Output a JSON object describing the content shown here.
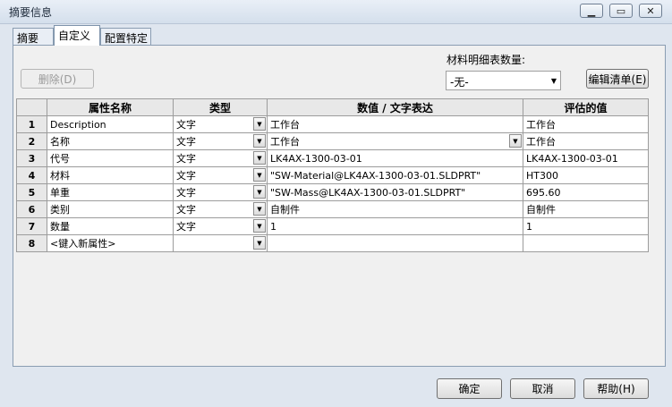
{
  "window": {
    "title": "摘要信息"
  },
  "tabs": [
    {
      "label": "摘要"
    },
    {
      "label": "自定义"
    },
    {
      "label": "配置特定"
    }
  ],
  "toolbar": {
    "delete_label": "删除(D)",
    "bom_qty_label": "材料明细表数量:",
    "bom_qty_value": "-无-",
    "edit_list_label": "编辑清单(E)"
  },
  "table": {
    "headers": [
      "属性名称",
      "类型",
      "数值 / 文字表达",
      "评估的值"
    ],
    "rows": [
      {
        "num": "1",
        "name": "Description",
        "type": "文字",
        "value": "工作台",
        "evaluated": "工作台"
      },
      {
        "num": "2",
        "name": "名称",
        "type": "文字",
        "value": "工作台",
        "evaluated": "工作台"
      },
      {
        "num": "3",
        "name": "代号",
        "type": "文字",
        "value": "LK4AX-1300-03-01",
        "evaluated": "LK4AX-1300-03-01"
      },
      {
        "num": "4",
        "name": "材料",
        "type": "文字",
        "value": "\"SW-Material@LK4AX-1300-03-01.SLDPRT\"",
        "evaluated": "HT300"
      },
      {
        "num": "5",
        "name": "单重",
        "type": "文字",
        "value": "\"SW-Mass@LK4AX-1300-03-01.SLDPRT\"",
        "evaluated": "695.60"
      },
      {
        "num": "6",
        "name": "类别",
        "type": "文字",
        "value": "自制件",
        "evaluated": "自制件"
      },
      {
        "num": "7",
        "name": "数量",
        "type": "文字",
        "value": "1",
        "evaluated": "1"
      },
      {
        "num": "8",
        "name": "<键入新属性>",
        "type": "",
        "value": "",
        "evaluated": ""
      }
    ]
  },
  "footer": {
    "ok_label": "确定",
    "cancel_label": "取消",
    "help_label": "帮助(H)"
  }
}
